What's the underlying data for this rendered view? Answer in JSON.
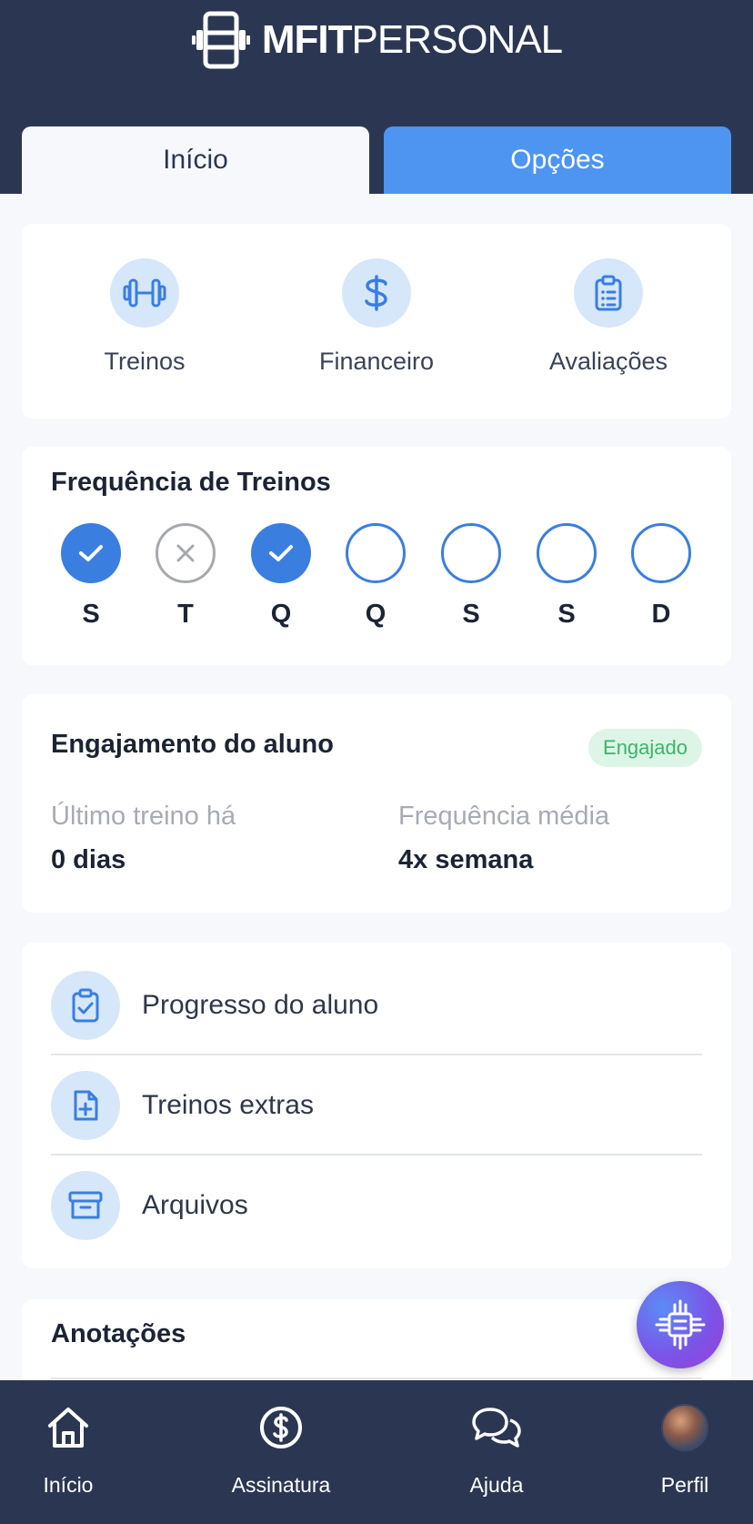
{
  "brand": {
    "name_bold": "MFIT",
    "name_light": "PERSONAL"
  },
  "tabs": [
    {
      "label": "Início",
      "active": true
    },
    {
      "label": "Opções",
      "active": false
    }
  ],
  "shortcuts": [
    {
      "label": "Treinos",
      "icon": "dumbbell-icon"
    },
    {
      "label": "Financeiro",
      "icon": "dollar-icon"
    },
    {
      "label": "Avaliações",
      "icon": "clipboard-icon"
    }
  ],
  "frequency": {
    "title": "Frequência de Treinos",
    "days": [
      {
        "letter": "S",
        "status": "done"
      },
      {
        "letter": "T",
        "status": "missed"
      },
      {
        "letter": "Q",
        "status": "done"
      },
      {
        "letter": "Q",
        "status": "pending"
      },
      {
        "letter": "S",
        "status": "pending"
      },
      {
        "letter": "S",
        "status": "pending"
      },
      {
        "letter": "D",
        "status": "pending"
      }
    ]
  },
  "engagement": {
    "title": "Engajamento do aluno",
    "badge": "Engajado",
    "last_workout_label": "Último treino há",
    "last_workout_value": "0 dias",
    "avg_frequency_label": "Frequência média",
    "avg_frequency_value": "4x semana"
  },
  "menu": [
    {
      "label": "Progresso do aluno",
      "icon": "clipboard-check-icon"
    },
    {
      "label": "Treinos extras",
      "icon": "file-plus-icon"
    },
    {
      "label": "Arquivos",
      "icon": "archive-icon"
    }
  ],
  "notes": {
    "title": "Anotações"
  },
  "bottom_nav": [
    {
      "label": "Início",
      "icon": "home-icon"
    },
    {
      "label": "Assinatura",
      "icon": "dollar-circle-icon"
    },
    {
      "label": "Ajuda",
      "icon": "chat-icon"
    },
    {
      "label": "Perfil",
      "icon": "avatar"
    }
  ],
  "colors": {
    "header": "#2b3752",
    "accent": "#3a7ee0",
    "tab_active_bg": "#4d95f0",
    "badge_bg": "#dcf5e6",
    "badge_text": "#3db46a"
  }
}
